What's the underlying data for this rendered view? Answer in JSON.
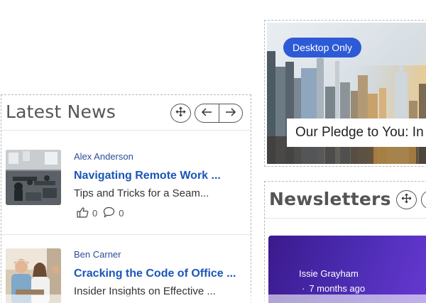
{
  "latest_news": {
    "title": "Latest News",
    "icons": {
      "move": "move-icon",
      "prev": "arrow-left-icon",
      "next": "arrow-right-icon"
    },
    "items": [
      {
        "author": "Alex Anderson",
        "title": "Navigating Remote Work ...",
        "excerpt": "Tips and Tricks for a Seam...",
        "likes": "0",
        "comments": "0",
        "image": "office-workspace-photo"
      },
      {
        "author": "Ben Carner",
        "title": "Cracking the Code of Office ...",
        "excerpt": "Insider Insights on Effective ...",
        "image": "colleagues-meeting-photo"
      }
    ]
  },
  "hero": {
    "badge": "Desktop Only",
    "caption": "Our Pledge to You: In",
    "image": "city-skyline-photo"
  },
  "newsletters": {
    "title": "Newsletters",
    "card": {
      "author": "Issie Grayham",
      "time": "7 months ago",
      "separator": "·"
    }
  },
  "colors": {
    "link": "#1a56b8",
    "author": "#2d4c9a",
    "badge": "#2d5ad6",
    "card_gradient_start": "#3b1a8c",
    "card_gradient_end": "#6a3ad6"
  }
}
